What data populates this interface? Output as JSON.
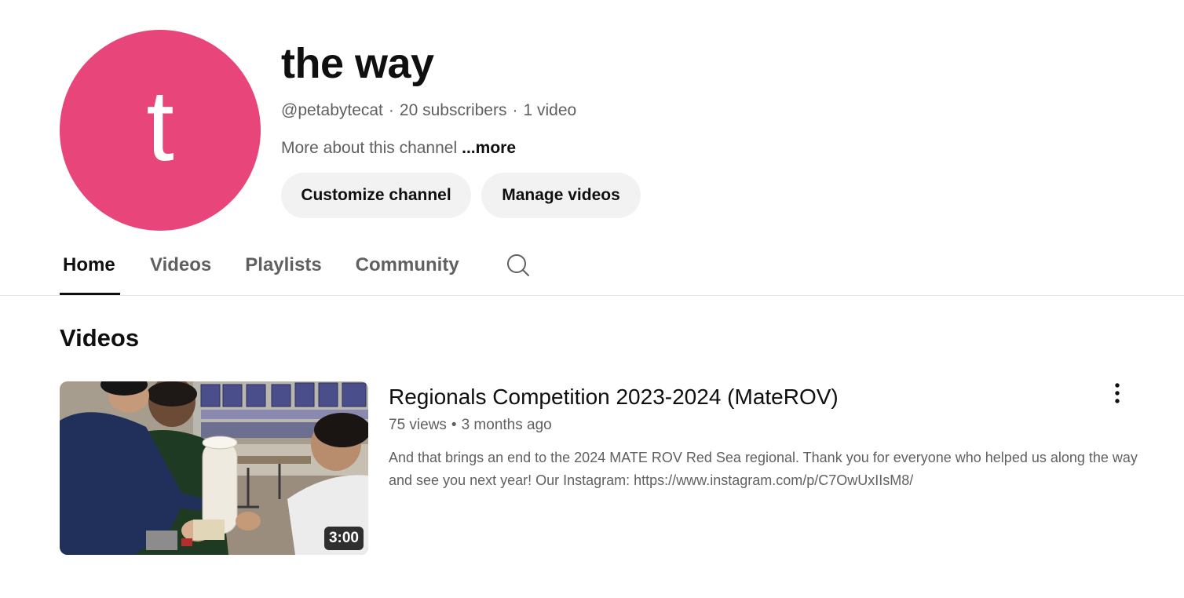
{
  "channel": {
    "avatar_letter": "t",
    "avatar_color": "#e8457a",
    "name": "the way",
    "handle": "@petabytecat",
    "subscribers": "20 subscribers",
    "video_count": "1 video",
    "separator": "·",
    "about_text": "More about this channel",
    "more_link": "...more"
  },
  "buttons": {
    "customize": "Customize channel",
    "manage": "Manage videos"
  },
  "tabs": [
    {
      "label": "Home",
      "active": true
    },
    {
      "label": "Videos",
      "active": false
    },
    {
      "label": "Playlists",
      "active": false
    },
    {
      "label": "Community",
      "active": false
    }
  ],
  "tab_search_icon": "search-icon",
  "section": {
    "title": "Videos"
  },
  "video": {
    "title": "Regionals Competition 2023-2024 (MateROV)",
    "views": "75 views",
    "age": "3 months ago",
    "separator": "•",
    "description": "And that brings an end to the 2024 MATE ROV Red Sea regional. Thank you for everyone who helped us along the way and see you next year! Our Instagram: https://www.instagram.com/p/C7OwUxIIsM8/",
    "duration": "3:00",
    "menu_icon": "more-vert-icon"
  }
}
